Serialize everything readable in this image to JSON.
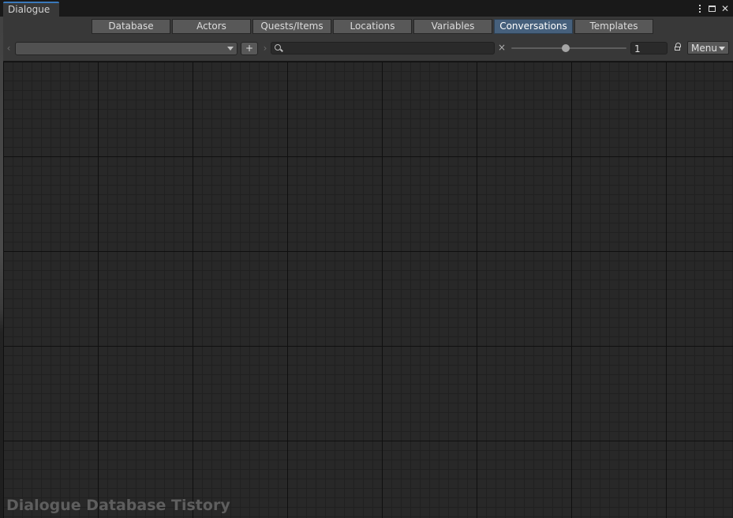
{
  "window": {
    "title": "Dialogue"
  },
  "tabs": [
    {
      "label": "Database",
      "active": false
    },
    {
      "label": "Actors",
      "active": false
    },
    {
      "label": "Quests/Items",
      "active": false
    },
    {
      "label": "Locations",
      "active": false
    },
    {
      "label": "Variables",
      "active": false
    },
    {
      "label": "Conversations",
      "active": true
    },
    {
      "label": "Templates",
      "active": false
    }
  ],
  "toolbar": {
    "conversation_select_value": "",
    "add_label": "+",
    "search_value": "",
    "clear_label": "×",
    "zoom_slider_fraction": 0.47,
    "zoom_value": "1",
    "menu_label": "Menu"
  },
  "canvas": {
    "watermark": "Dialogue Database Tistory"
  },
  "colors": {
    "active_tab": "#46607c",
    "title_accent": "#3a79bb",
    "canvas_bg": "#282828"
  },
  "icons": {
    "kebab": "vertical-dots-icon",
    "maximize": "maximize-icon",
    "close": "close-icon",
    "search": "search-icon",
    "lock": "lock-icon",
    "dropdown": "chevron-down-icon"
  }
}
